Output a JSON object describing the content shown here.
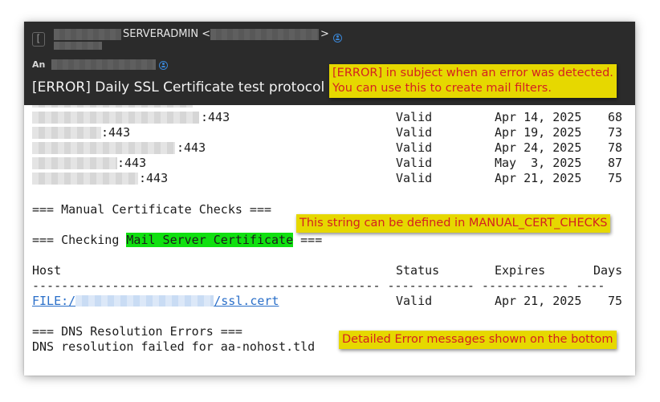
{
  "email": {
    "sender_name": "SERVERADMIN <",
    "sender_close": ">",
    "to_label": "An",
    "subject": "[ERROR] Daily SSL Certificate test protocol"
  },
  "rows": [
    {
      "host_suffix": ":443",
      "status": "Valid",
      "expires": "Apr 14, 2025",
      "days": "68"
    },
    {
      "host_suffix": ":443",
      "status": "Valid",
      "expires": "Apr 19, 2025",
      "days": "73"
    },
    {
      "host_suffix": ":443",
      "status": "Valid",
      "expires": "Apr 24, 2025",
      "days": "78"
    },
    {
      "host_suffix": ":443",
      "status": "Valid",
      "expires": "May  3, 2025",
      "days": "87"
    },
    {
      "host_suffix": ":443",
      "status": "Valid",
      "expires": "Apr 21, 2025",
      "days": "75"
    }
  ],
  "manual_heading": "=== Manual Certificate Checks ===",
  "checking": {
    "prefix": "=== Checking ",
    "name": "Mail Server Certificate",
    "suffix": " ==="
  },
  "table": {
    "headers": {
      "host": "Host",
      "status": "Status",
      "expires": "Expires",
      "days": "Days"
    },
    "separator": "------------------------------------------------ ------------ ------------ ----",
    "row": {
      "host_prefix": "FILE:/",
      "host_suffix": "/ssl.cert",
      "status": "Valid",
      "expires": "Apr 21, 2025",
      "days": "75"
    }
  },
  "dns": {
    "heading": "=== DNS Resolution Errors ===",
    "message": "DNS resolution failed for aa-nohost.tld"
  },
  "callouts": {
    "subject": "[ERROR] in subject when an error was detected.\nYou can use this to create mail filters.",
    "manual": "This string can be defined in MANUAL_CERT_CHECKS",
    "errors": "Detailed Error messages shown on the bottom"
  },
  "colors": {
    "header_bg": "#2b2b2b",
    "callout_bg": "#e6d800",
    "callout_text": "#d42020",
    "highlight": "#10e010",
    "link": "#2a6fc9"
  }
}
